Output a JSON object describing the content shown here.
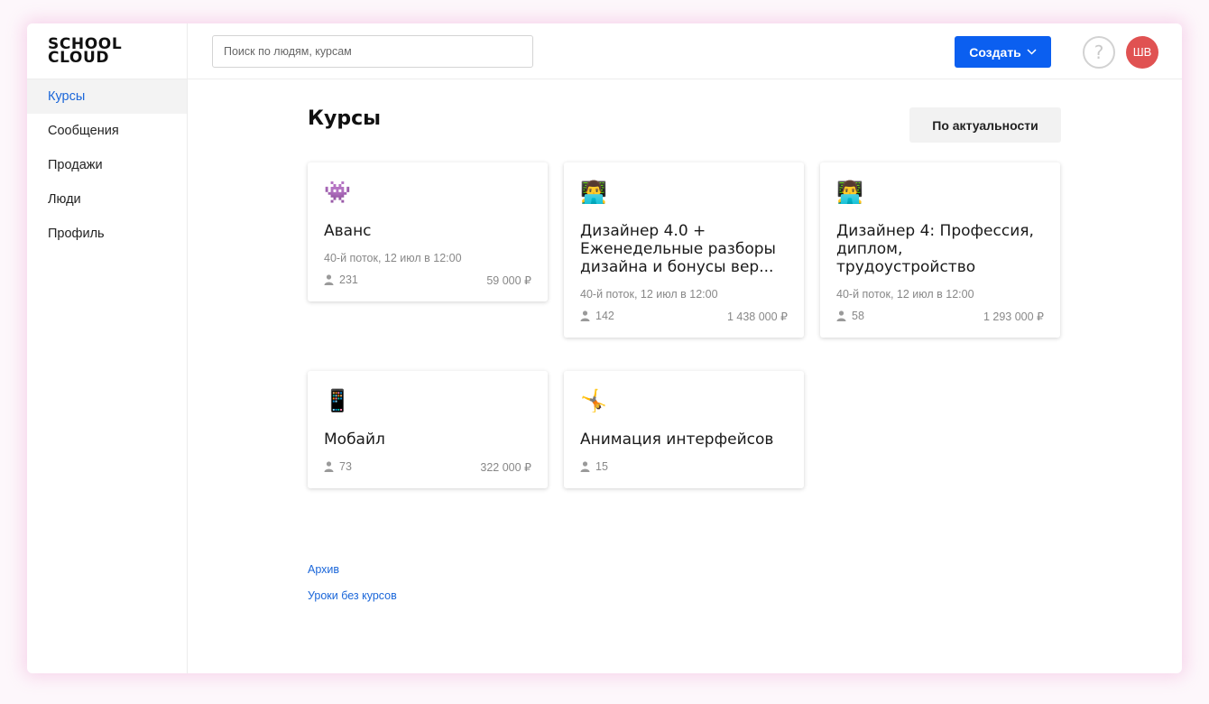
{
  "logo": {
    "line1": "SCHOOL",
    "line2": "CLOUD"
  },
  "sidebar": {
    "items": [
      {
        "label": "Курсы",
        "active": true
      },
      {
        "label": "Сообщения"
      },
      {
        "label": "Продажи"
      },
      {
        "label": "Люди"
      },
      {
        "label": "Профиль"
      }
    ]
  },
  "header": {
    "search_placeholder": "Поиск по людям, курсам",
    "create_label": "Создать",
    "help_label": "?",
    "avatar_initials": "ШВ"
  },
  "main": {
    "title": "Курсы",
    "sort_label": "По актуальности",
    "courses": [
      {
        "icon": "👾",
        "title": "Аванс",
        "subtitle": "40-й поток, 12 июл в 12:00",
        "students": "231",
        "price": "59 000 ₽"
      },
      {
        "icon": "👨‍💻",
        "title": "Дизайнер 4.0 + Еженедельные разборы дизайна и бонусы вер...",
        "subtitle": "40-й поток, 12 июл в 12:00",
        "students": "142",
        "price": "1 438 000 ₽"
      },
      {
        "icon": "👨‍💻",
        "title": "Дизайнер 4: Профессия, диплом, трудоустройство",
        "subtitle": "40-й поток, 12 июл в 12:00",
        "students": "58",
        "price": "1 293 000 ₽"
      },
      {
        "icon": "📱",
        "title": "Мобайл",
        "subtitle": "",
        "students": "73",
        "price": "322 000 ₽"
      },
      {
        "icon": "🤸",
        "title": "Анимация интерфейсов",
        "subtitle": "",
        "students": "15",
        "price": ""
      }
    ],
    "links": {
      "archive": "Архив",
      "lessons_without_courses": "Уроки без курсов"
    }
  },
  "colors": {
    "accent": "#0b5ff0",
    "link": "#1a66d9",
    "avatar": "#e05252"
  }
}
